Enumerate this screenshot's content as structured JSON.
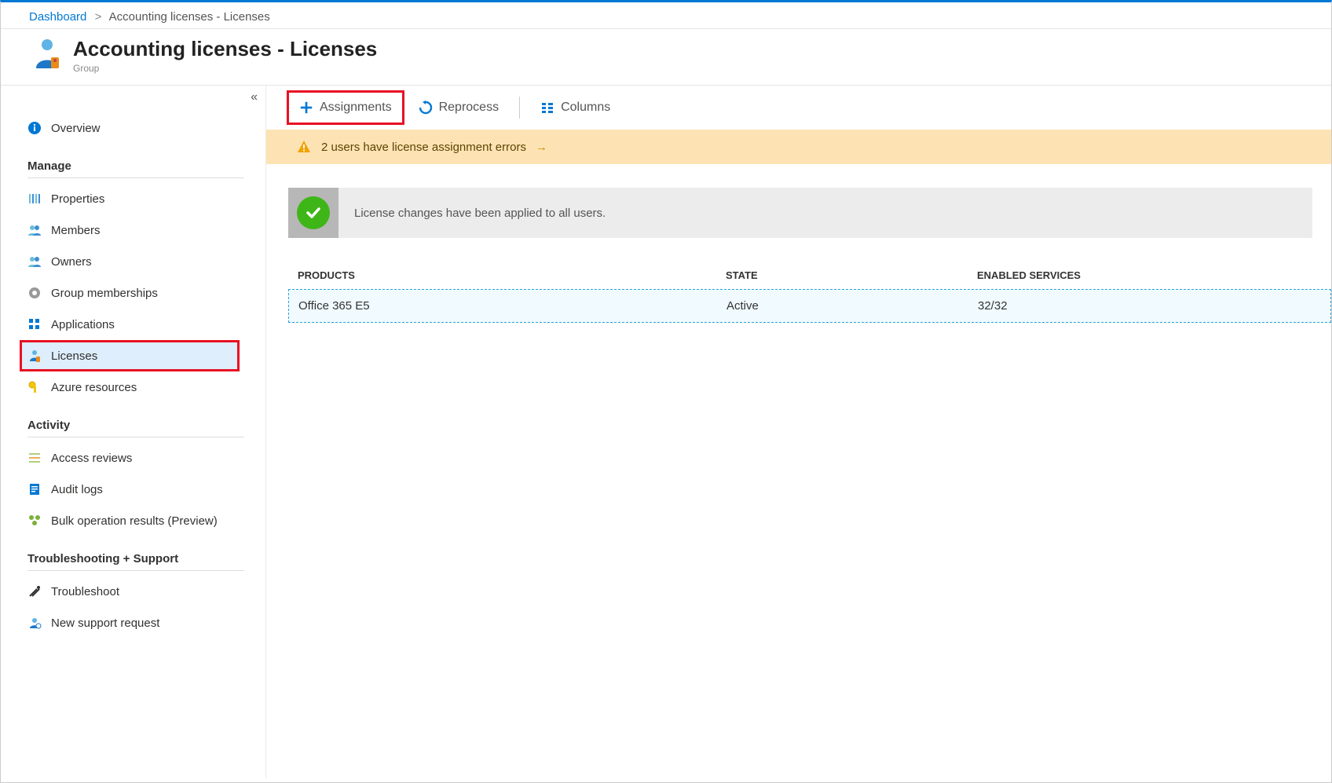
{
  "breadcrumb": {
    "root": "Dashboard",
    "current": "Accounting licenses - Licenses"
  },
  "header": {
    "title": "Accounting licenses - Licenses",
    "subtitle": "Group"
  },
  "sidebar": {
    "overview": "Overview",
    "sections": {
      "manage": "Manage",
      "activity": "Activity",
      "support": "Troubleshooting + Support"
    },
    "items": {
      "properties": "Properties",
      "members": "Members",
      "owners": "Owners",
      "groupMemberships": "Group memberships",
      "applications": "Applications",
      "licenses": "Licenses",
      "azureResources": "Azure resources",
      "accessReviews": "Access reviews",
      "auditLogs": "Audit logs",
      "bulkOps": "Bulk operation results (Preview)",
      "troubleshoot": "Troubleshoot",
      "newSupport": "New support request"
    }
  },
  "toolbar": {
    "assignments": "Assignments",
    "reprocess": "Reprocess",
    "columns": "Columns"
  },
  "warning": {
    "text": "2 users have license assignment errors"
  },
  "success": {
    "text": "License changes have been applied to all users."
  },
  "table": {
    "headers": {
      "products": "Products",
      "state": "State",
      "services": "Enabled Services"
    },
    "rows": [
      {
        "product": "Office 365 E5",
        "state": "Active",
        "services": "32/32"
      }
    ]
  }
}
